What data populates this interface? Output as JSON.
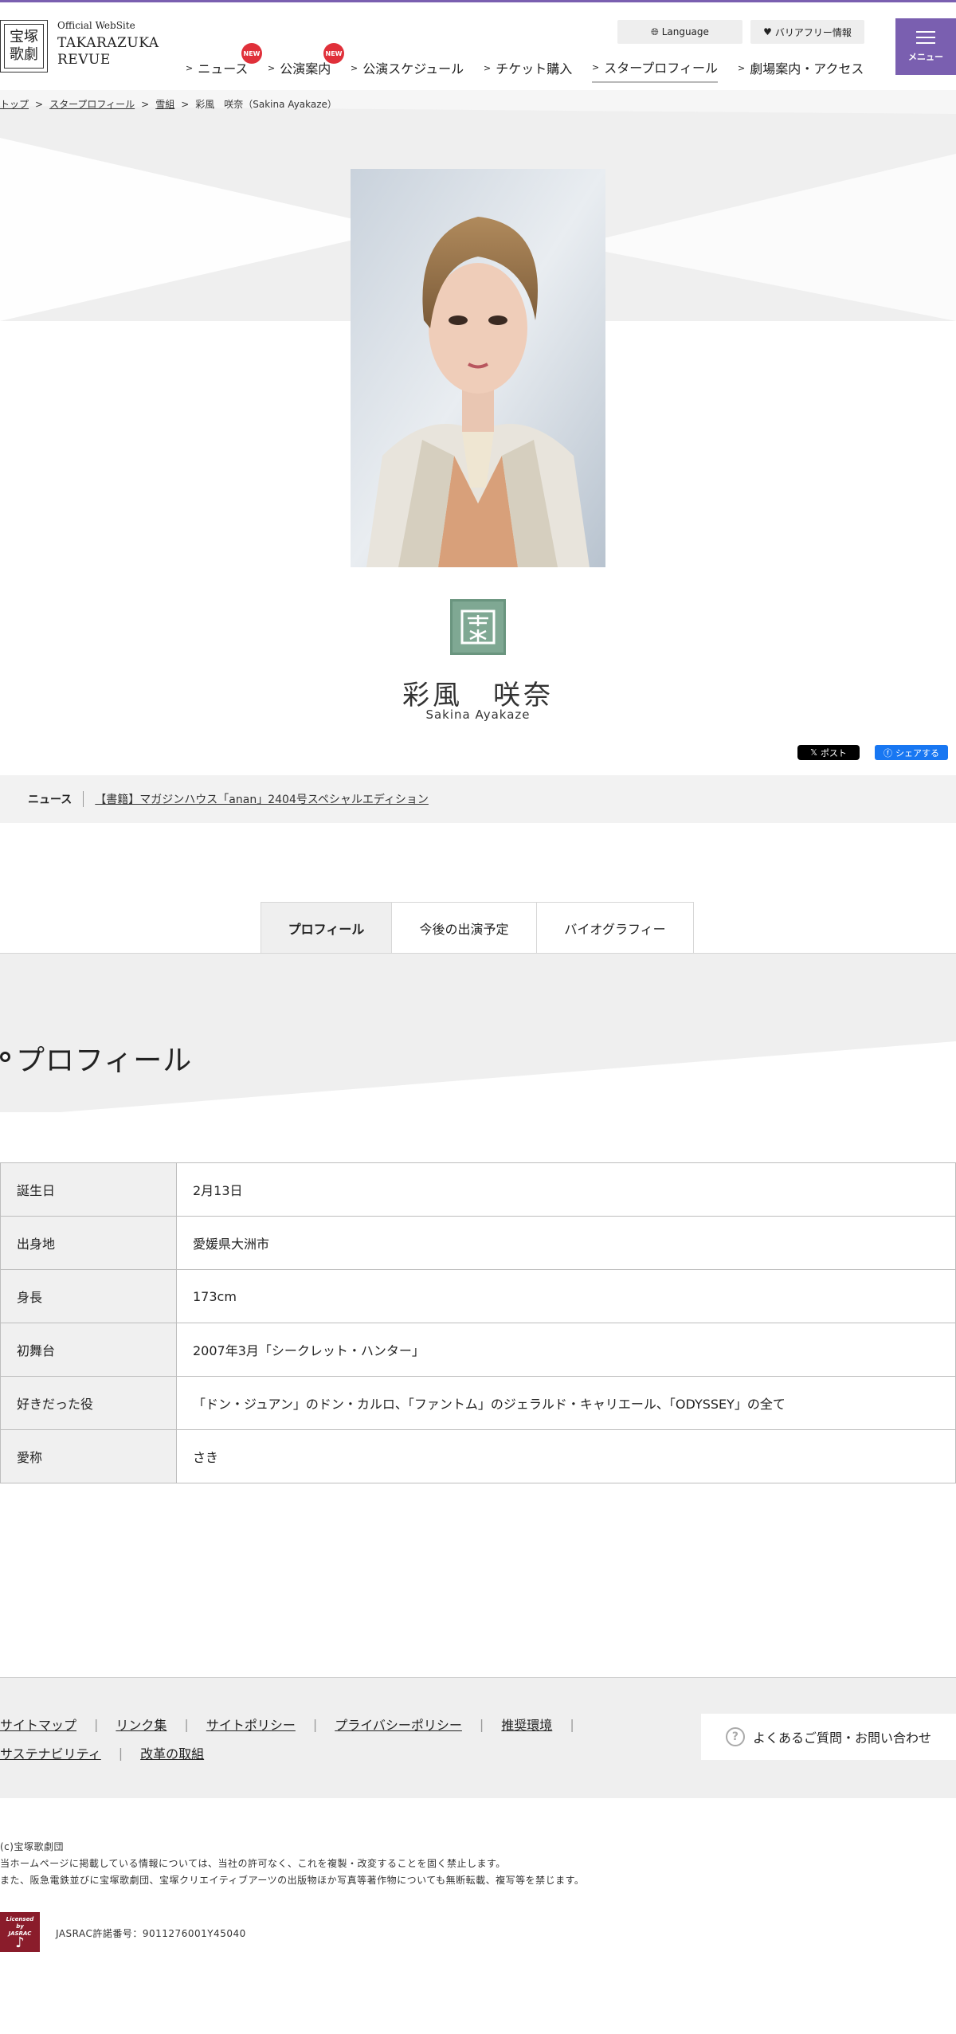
{
  "header": {
    "logo_text": [
      "宝塚",
      "歌劇"
    ],
    "site_eyebrow": "Official WebSite",
    "site_title_line1": "TAKARAZUKA",
    "site_title_line2": "REVUE",
    "language_label": "Language",
    "barrier_free_label": "バリアフリー情報",
    "menu_label": "メニュー",
    "new_badge": "NEW",
    "nav": [
      {
        "label": "ニュース",
        "new": true
      },
      {
        "label": "公演案内",
        "new": true
      },
      {
        "label": "公演スケジュール",
        "new": false
      },
      {
        "label": "チケット購入",
        "new": false
      },
      {
        "label": "スタープロフィール",
        "new": false
      },
      {
        "label": "劇場案内・アクセス",
        "new": false
      }
    ],
    "accent_color": "#7a5fb0"
  },
  "breadcrumb": [
    "トップ",
    "スタープロフィール",
    "雪組",
    "彩風　咲奈（Sakina Ayakaze）"
  ],
  "star": {
    "name_ja": "彩風　咲奈",
    "name_en": "Sakina Ayakaze",
    "troupe_emblem_color": "#7fa893"
  },
  "share": {
    "x_label": "ポスト",
    "fb_label": "シェアする"
  },
  "news": {
    "label": "ニュース",
    "headline": "【書籍】マガジンハウス「anan」2404号スペシャルエディション"
  },
  "tabs": [
    "プロフィール",
    "今後の出演予定",
    "バイオグラフィー"
  ],
  "section_title": "プロフィール",
  "profile": [
    {
      "key": "誕生日",
      "value": "2月13日"
    },
    {
      "key": "出身地",
      "value": "愛媛県大洲市"
    },
    {
      "key": "身長",
      "value": "173cm"
    },
    {
      "key": "初舞台",
      "value": "2007年3月「シークレット・ハンター」"
    },
    {
      "key": "好きだった役",
      "value": "「ドン・ジュアン」のドン・カルロ、「ファントム」のジェラルド・キャリエール、「ODYSSEY」の全て"
    },
    {
      "key": "愛称",
      "value": "さき"
    }
  ],
  "footer": {
    "links_row1": [
      "サイトマップ",
      "リンク集",
      "サイトポリシー",
      "プライバシーポリシー",
      "推奨環境"
    ],
    "links_row2": [
      "サステナビリティ",
      "改革の取組"
    ],
    "faq_label": "よくあるご質問・お問い合わせ",
    "copyright": "(c)宝塚歌劇団",
    "notice1": "当ホームページに掲載している情報については、当社の許可なく、これを複製・改変することを固く禁止します。",
    "notice2": "また、阪急電鉄並びに宝塚歌劇団、宝塚クリエイティブアーツの出版物ほか写真等著作物についても無断転載、複写等を禁じます。",
    "jasrac_logo": [
      "Licensed",
      "by",
      "JASRAC"
    ],
    "jasrac_number": "JASRAC許諾番号：9011276001Y45040"
  }
}
